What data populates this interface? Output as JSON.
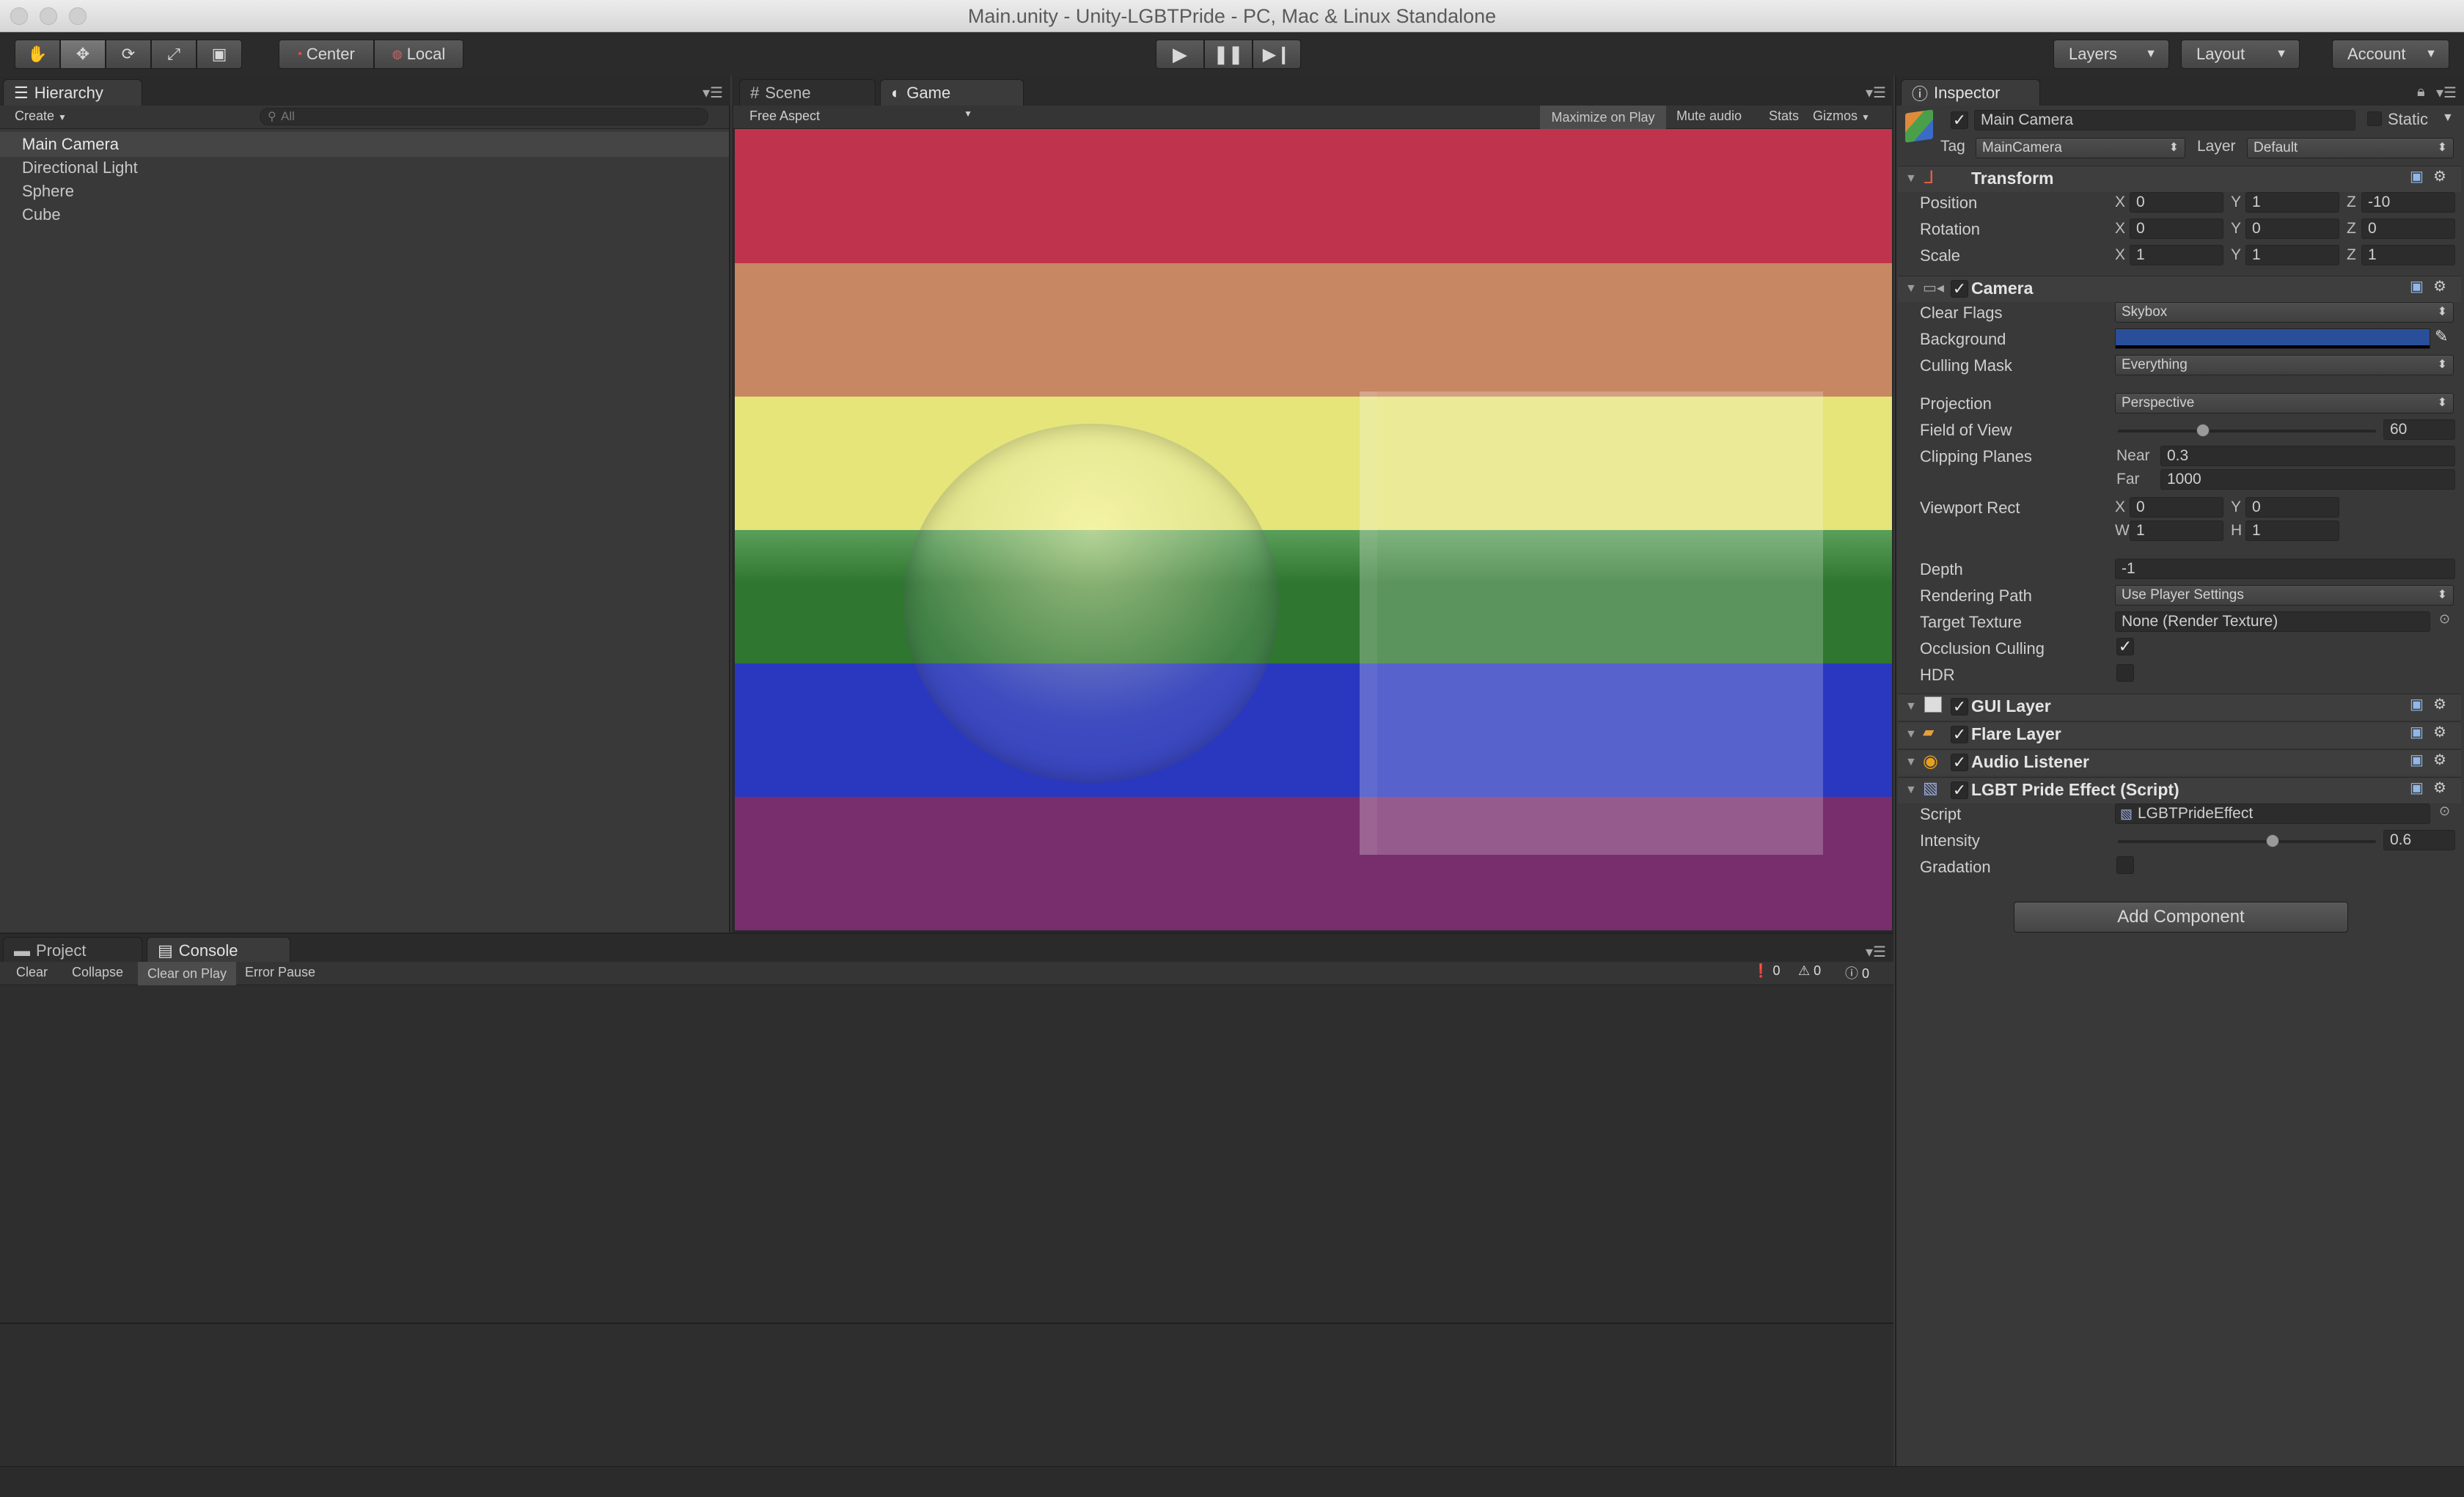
{
  "window": {
    "title": "Main.unity - Unity-LGBTPride - PC, Mac & Linux Standalone"
  },
  "toolbar": {
    "tools": [
      "hand-tool",
      "move-tool",
      "rotate-tool",
      "scale-tool",
      "rect-tool"
    ],
    "pivot_label": "Center",
    "space_label": "Local",
    "layers_label": "Layers",
    "layout_label": "Layout",
    "account_label": "Account"
  },
  "hierarchy": {
    "tab_label": "Hierarchy",
    "create_label": "Create",
    "search_placeholder": "All",
    "items": [
      "Main Camera",
      "Directional Light",
      "Sphere",
      "Cube"
    ]
  },
  "game": {
    "scene_tab": "Scene",
    "game_tab": "Game",
    "aspect": "Free Aspect",
    "maximize_on_play": "Maximize on Play",
    "mute_audio": "Mute audio",
    "stats": "Stats",
    "gizmos": "Gizmos",
    "flag_colors": [
      "#bf344c",
      "#c78762",
      "#e5e57a",
      "#2f7630",
      "#2a37bf",
      "#782e6c"
    ]
  },
  "console": {
    "project_tab": "Project",
    "console_tab": "Console",
    "clear": "Clear",
    "collapse": "Collapse",
    "clear_on_play": "Clear on Play",
    "error_pause": "Error Pause",
    "error_count": "0",
    "warning_count": "0",
    "message_count": "0"
  },
  "inspector": {
    "tab_label": "Inspector",
    "object_name": "Main Camera",
    "static_label": "Static",
    "tag_label": "Tag",
    "tag_value": "MainCamera",
    "layer_label": "Layer",
    "layer_value": "Default",
    "transform": {
      "title": "Transform",
      "position_label": "Position",
      "pos": {
        "x": "0",
        "y": "1",
        "z": "-10"
      },
      "rotation_label": "Rotation",
      "rot": {
        "x": "0",
        "y": "0",
        "z": "0"
      },
      "scale_label": "Scale",
      "scale": {
        "x": "1",
        "y": "1",
        "z": "1"
      }
    },
    "camera": {
      "title": "Camera",
      "clear_flags_label": "Clear Flags",
      "clear_flags": "Skybox",
      "background_label": "Background",
      "background_color": "#2a4f9a",
      "culling_mask_label": "Culling Mask",
      "culling_mask": "Everything",
      "projection_label": "Projection",
      "projection": "Perspective",
      "fov_label": "Field of View",
      "fov": "60",
      "fov_fraction": 0.33,
      "clipping_label": "Clipping Planes",
      "near_label": "Near",
      "near": "0.3",
      "far_label": "Far",
      "far": "1000",
      "viewport_label": "Viewport Rect",
      "vx": "0",
      "vy": "0",
      "vw": "1",
      "vh": "1",
      "depth_label": "Depth",
      "depth": "-1",
      "rendering_path_label": "Rendering Path",
      "rendering_path": "Use Player Settings",
      "target_texture_label": "Target Texture",
      "target_texture": "None (Render Texture)",
      "occlusion_label": "Occlusion Culling",
      "occlusion": true,
      "hdr_label": "HDR",
      "hdr": false
    },
    "gui_layer": "GUI Layer",
    "flare_layer": "Flare Layer",
    "audio_listener": "Audio Listener",
    "pride_effect": {
      "title": "LGBT Pride Effect (Script)",
      "script_label": "Script",
      "script_value": "LGBTPrideEffect",
      "intensity_label": "Intensity",
      "intensity": "0.6",
      "intensity_fraction": 0.6,
      "gradation_label": "Gradation",
      "gradation": false
    },
    "add_component": "Add Component"
  }
}
